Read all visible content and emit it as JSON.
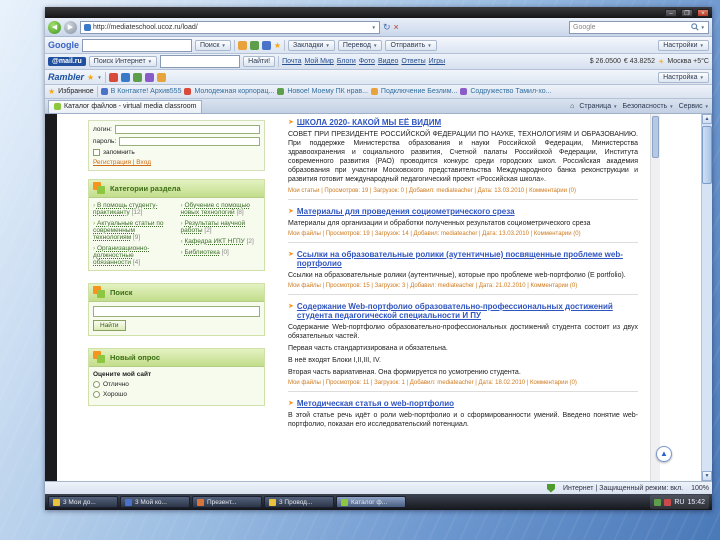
{
  "browser": {
    "url": "http://mediateschool.ucoz.ru/load/",
    "search_engine": "Google",
    "page_title": "Каталог файлов - virtual media classroom",
    "window_buttons": {
      "minimize": "–",
      "maximize": "❐",
      "close": "×"
    }
  },
  "google_toolbar": {
    "logo": "Google",
    "search_button": "Поиск",
    "links": [
      "Закладки",
      "Перевод",
      "Отправить"
    ],
    "settings": "Настройки"
  },
  "mailru_toolbar": {
    "logo": "@mail.ru",
    "scope": "Поиск Интернет",
    "find_button": "Найти!",
    "links": [
      "Почта",
      "Мой Мир",
      "Блоги",
      "Фото",
      "Видео",
      "Ответы",
      "Игры"
    ],
    "usd": "$ 26.0500",
    "eur": "€ 43.8252",
    "weather": "Москва +5°C"
  },
  "rambler_toolbar": {
    "logo": "Rambler",
    "settings": "Настройка"
  },
  "favorites_bar": {
    "label": "Избранное",
    "links": [
      "В Контакте! Архив555",
      "Молодежная корпорац...",
      "Новое! Моему ПК нрав...",
      "Подключение Безлим...",
      "Содружество Тамил-хо..."
    ]
  },
  "command_bar": {
    "items": [
      "Страница",
      "Безопасность",
      "Сервис"
    ]
  },
  "sidebar": {
    "login": {
      "login_label": "логин:",
      "password_label": "пароль:",
      "remember_label": "запомнить",
      "links": "Регистрация | Вход"
    },
    "categories": {
      "title": "Категории раздела",
      "items": [
        {
          "label": "В помощь студенту-практиканту",
          "count": "[12]"
        },
        {
          "label": "Актуальные статьи по современным технологиям",
          "count": "[9]"
        },
        {
          "label": "Организационно-должностные обязанности",
          "count": "[4]"
        },
        {
          "label": "Обучение с помощью новых технологий",
          "count": "[8]"
        },
        {
          "label": "Результаты научной работы",
          "count": "[2]"
        },
        {
          "label": "Кафедра ИКТ НГПУ",
          "count": "[2]"
        },
        {
          "label": "Библиотека",
          "count": "[0]"
        }
      ]
    },
    "search": {
      "title": "Поиск",
      "button": "Найти"
    },
    "poll": {
      "title": "Новый опрос",
      "question": "Оцените мой сайт",
      "options": [
        "Отлично",
        "Хорошо"
      ]
    }
  },
  "main": {
    "entries": [
      {
        "title": "ШКОЛА 2020- КАКОЙ МЫ ЕЁ ВИДИМ",
        "description": "СОВЕТ ПРИ ПРЕЗИДЕНТЕ РОССИЙСКОЙ ФЕДЕРАЦИИ ПО НАУКЕ, ТЕХНОЛОГИЯМ И ОБРАЗОВАНИЮ. При поддержке Министерства образования и науки Российской Федерации, Министерства здравоохранения и социального развития, Счетной палаты Российской Федерации, Института современного развития (РАО) проводится конкурс среди городских школ. Российская академия образования при участии Московского представительства Международного банка реконструкции и развития готовит международный педагогический проект «Российская школа».",
        "meta": "Мои статьи | Просмотров: 19 | Загрузок: 0 | Добавил: mediateacher | Дата: 13.03.2010 | Комментарии (0)"
      },
      {
        "title": "Материалы для проведения социометрического среза",
        "description": "Материалы для организации и обработки полученных результатов социометрического среза",
        "meta": "Мои файлы | Просмотров: 19 | Загрузок: 14 | Добавил: mediateacher | Дата: 13.03.2010 | Комментарии (0)"
      },
      {
        "title": "Ссылки на образовательные ролики (аутентичные) посвященные проблеме web-портфолио",
        "description": "Ссылки на образовательные ролики (аутентичные), которые про проблеме web-портфолио (Е portfolio).",
        "meta": "Мои файлы | Просмотров: 15 | Загрузок: 3 | Добавил: mediateacher | Дата: 21.02.2010 | Комментарии (0)"
      },
      {
        "title": "Содержание Web-портфолио образовательно-профессиональных достижений студента педагогической специальности И ПУ",
        "description_lines": [
          "Содержание Web-портфолио образовательно-профессиональных достижений студента состоит из двух обязательных частей.",
          "Первая часть стандартизирована и обязательна.",
          "В неё входят Блоки I,II,III, IV.",
          "Вторая часть вариативная. Она формируется по усмотрению студента."
        ],
        "meta": "Мои файлы | Просмотров: 11 | Загрузок: 1 | Добавил: mediateacher | Дата: 18.02.2010 | Комментарии (0)"
      },
      {
        "title": "Методическая статья о web-портфолио",
        "description": "В этой статье речь идёт о роли web-портфолио и о сформированности умений. Введено понятие web-портфолио, показан его исследовательский потенциал."
      }
    ]
  },
  "statusbar": {
    "zone": "Интернет | Защищенный режим: вкл.",
    "zoom": "100%"
  },
  "taskbar": {
    "buttons": [
      "3 Мои до...",
      "3 Мой ко...",
      "Презент...",
      "3 Провод...",
      "Каталог ф..."
    ],
    "tray_lang": "RU",
    "clock": "15:42"
  }
}
